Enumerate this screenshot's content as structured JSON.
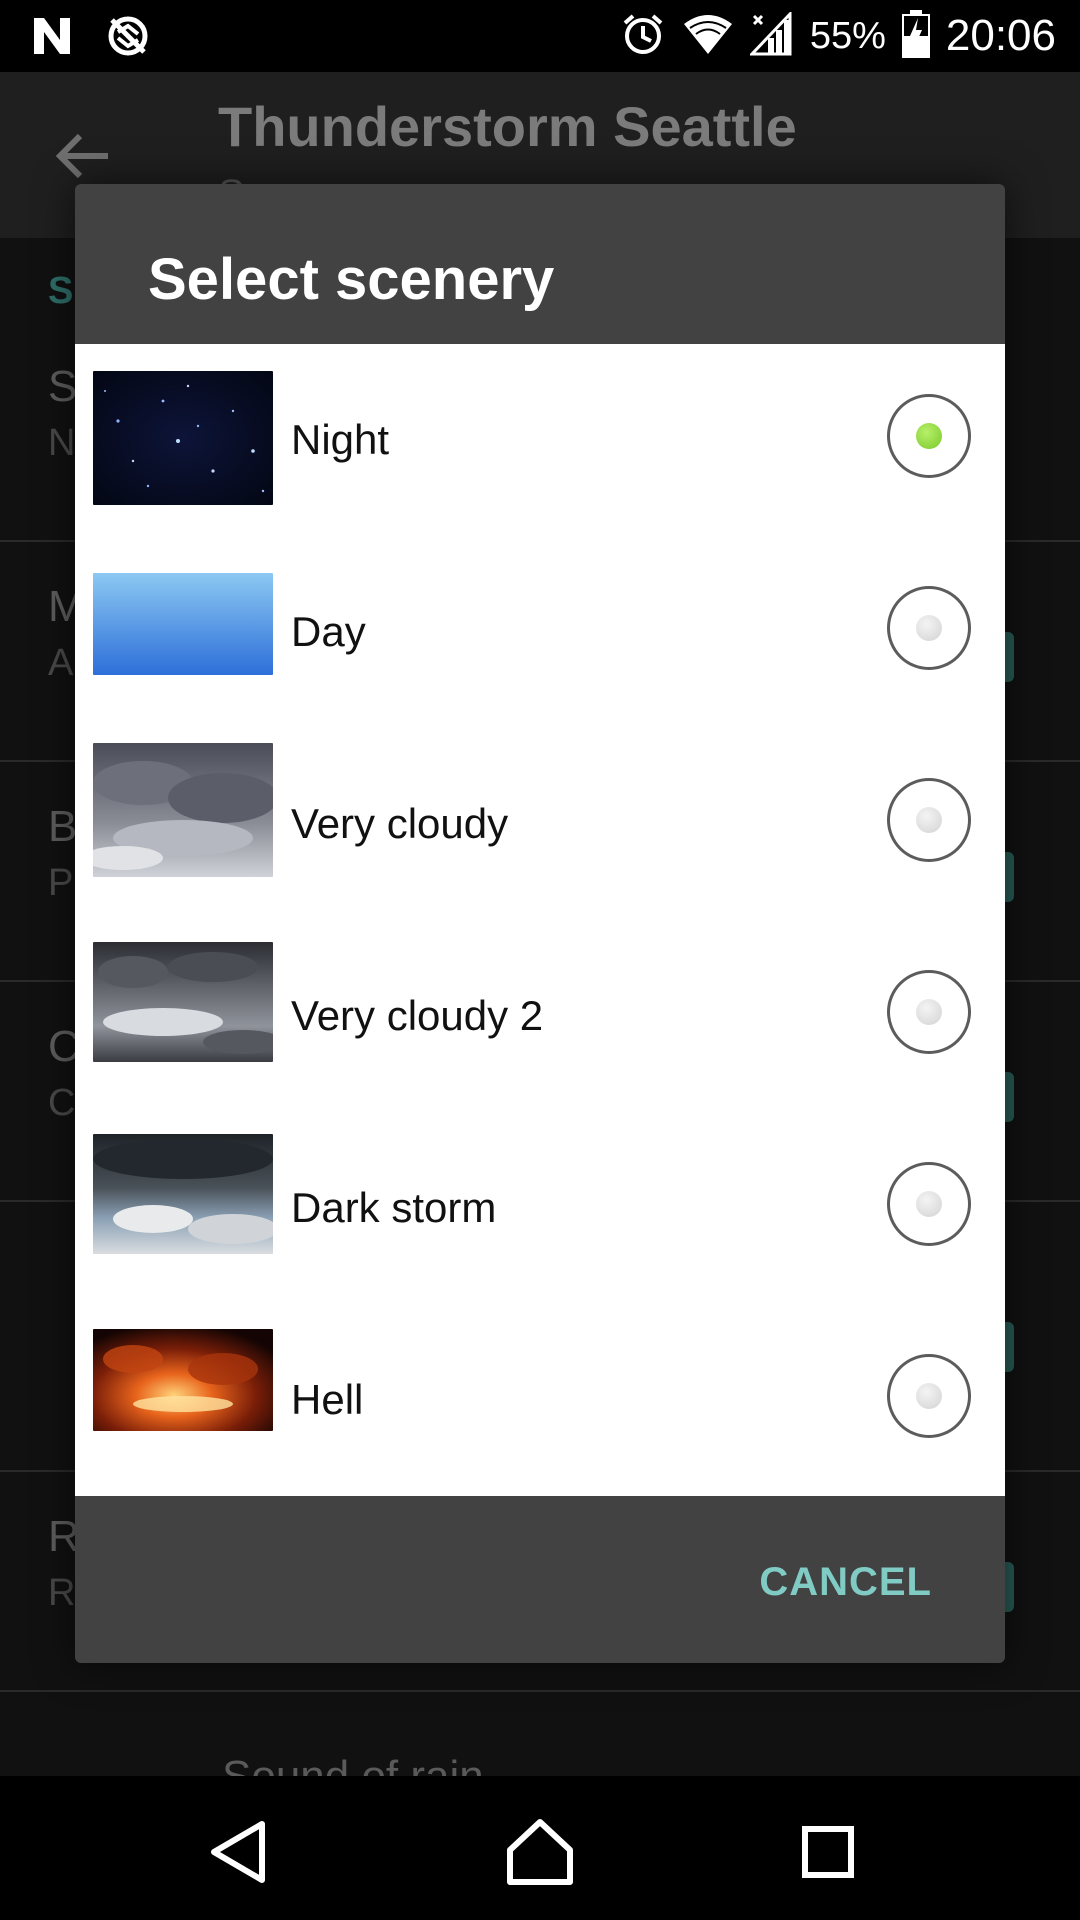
{
  "status_bar": {
    "battery_percent": "55%",
    "time": "20:06",
    "icons": [
      "n-logo-icon",
      "no-sync-icon",
      "alarm-icon",
      "wifi-icon",
      "signal-icon",
      "battery-icon"
    ]
  },
  "background_app": {
    "title": "Thunderstorm Seattle",
    "subtitle": "S...",
    "section_header": "S",
    "rows": [
      {
        "title": "S",
        "sub": "N"
      },
      {
        "title": "M",
        "sub": "A"
      },
      {
        "title": "B",
        "sub": "P"
      },
      {
        "title": "C",
        "sub": "C"
      },
      {
        "title": "",
        "sub": ""
      },
      {
        "title": "R",
        "sub": "R"
      }
    ],
    "bottom_label": "Sound of rain"
  },
  "dialog": {
    "title": "Select scenery",
    "options": [
      {
        "label": "Night",
        "selected": true
      },
      {
        "label": "Day",
        "selected": false
      },
      {
        "label": "Very cloudy",
        "selected": false
      },
      {
        "label": "Very cloudy 2",
        "selected": false
      },
      {
        "label": "Dark storm",
        "selected": false
      },
      {
        "label": "Hell",
        "selected": false
      }
    ],
    "cancel_label": "CANCEL"
  },
  "colors": {
    "accent": "#80cbc4",
    "selected_radio": "#7ac82a",
    "dialog_bg": "#424242"
  }
}
